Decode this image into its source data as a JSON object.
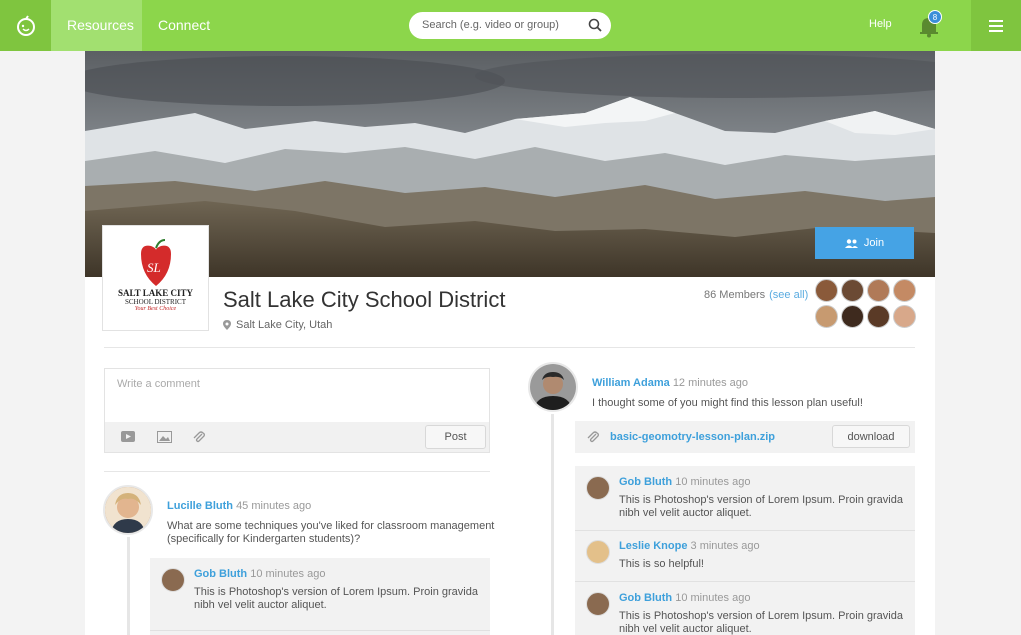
{
  "nav": {
    "tabs": [
      {
        "label": "Resources"
      },
      {
        "label": "Connect"
      }
    ],
    "search_placeholder": "Search (e.g. video or group)",
    "help_label": "Help",
    "notification_count": "8",
    "accent_color": "#8cd64b"
  },
  "district": {
    "name": "Salt Lake City School District",
    "location": "Salt Lake City, Utah",
    "logo_line1": "SALT LAKE CITY",
    "logo_line2": "SCHOOL DISTRICT",
    "logo_tagline": "Your Best Choice",
    "join_label": "Join",
    "members_count": "86 Members",
    "see_all": "(see all)"
  },
  "composer": {
    "placeholder": "Write a comment",
    "post_label": "Post"
  },
  "left_post": {
    "author": "Lucille Bluth",
    "time": "45 minutes ago",
    "text": "What are some techniques you've liked for classroom management (specifically for Kindergarten students)?",
    "replies": [
      {
        "author": "Gob Bluth",
        "time": "10 minutes ago",
        "text": "This is Photoshop's version  of Lorem Ipsum. Proin gravida nibh vel velit auctor aliquet."
      }
    ]
  },
  "right_post": {
    "author": "William Adama",
    "time": "12 minutes ago",
    "text": "I thought some of you might find this lesson plan useful!",
    "attachment": "basic-geomotry-lesson-plan.zip",
    "download_label": "download",
    "replies": [
      {
        "author": "Gob Bluth",
        "time": "10 minutes ago",
        "text": "This is Photoshop's version  of Lorem Ipsum. Proin gravida nibh vel velit auctor aliquet."
      },
      {
        "author": "Leslie Knope",
        "time": "3 minutes ago",
        "text": "This is so helpful!"
      },
      {
        "author": "Gob Bluth",
        "time": "10 minutes ago",
        "text": "This is Photoshop's version  of Lorem Ipsum. Proin gravida nibh vel velit auctor aliquet."
      }
    ]
  }
}
